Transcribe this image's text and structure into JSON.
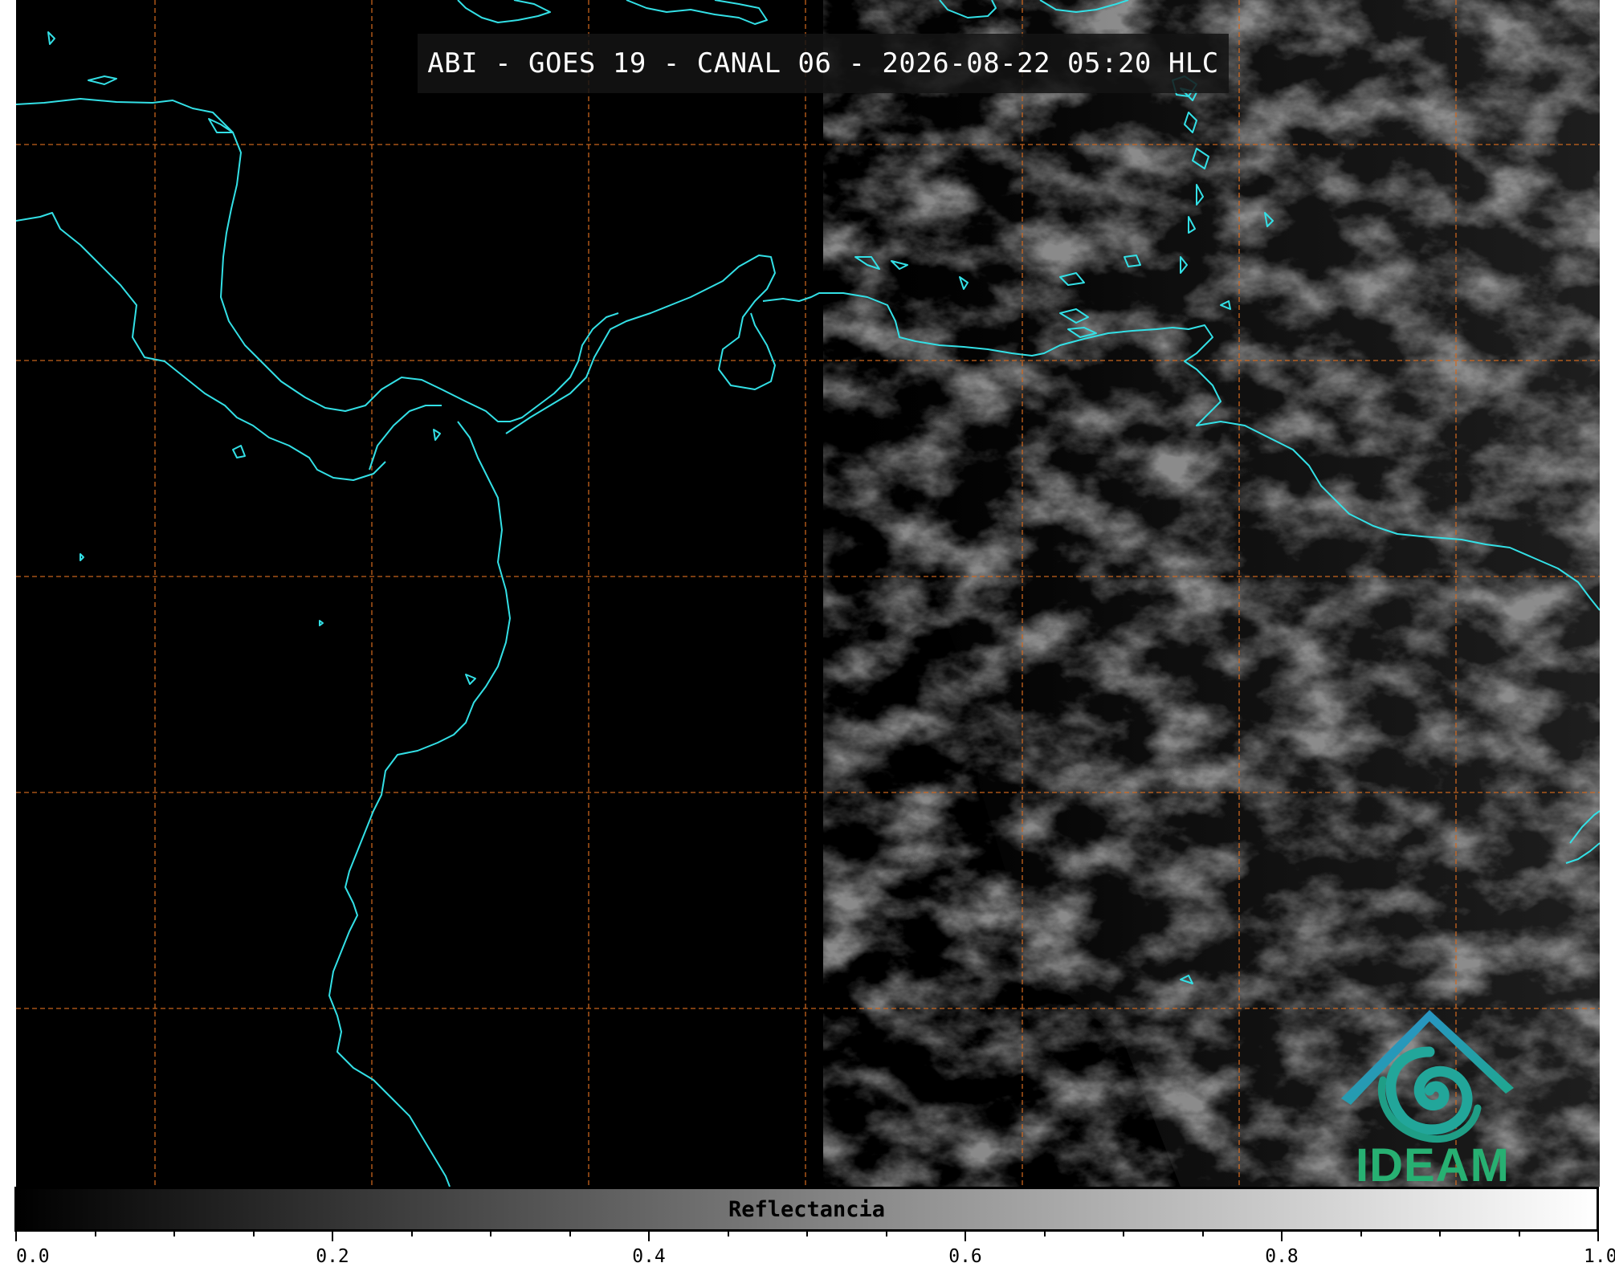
{
  "title": "ABI - GOES 19 - CANAL 06 - 2026-08-22 05:20 HLC",
  "colorbar": {
    "label": "Reflectancia",
    "min": 0.0,
    "max": 1.0,
    "colormap": "grayscale",
    "tick_labels": [
      "0.0",
      "0.2",
      "0.4",
      "0.6",
      "0.8",
      "1.0"
    ]
  },
  "logo": {
    "text": "IDEAM"
  },
  "colors": {
    "coastline": "#33e0e6",
    "gridline": "#d2691e",
    "background": "#000000"
  }
}
